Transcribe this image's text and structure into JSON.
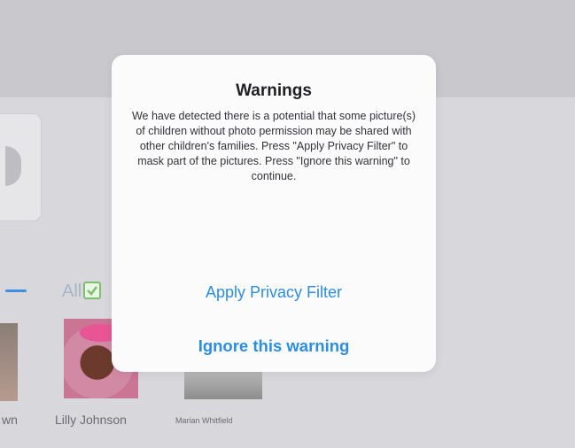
{
  "background": {
    "tab_label": "All",
    "students": [
      {
        "name": "wn"
      },
      {
        "name": "Lilly Johnson"
      },
      {
        "name": "Marian Whitfield"
      }
    ]
  },
  "dialog": {
    "title": "Warnings",
    "message": "We have detected there is a potential that some picture(s) of children without photo permission may be shared with other children's families. Press \"Apply Privacy Filter\" to mask part of the pictures. Press \"Ignore this warning\" to continue.",
    "primary_action": "Apply Privacy Filter",
    "secondary_action": "Ignore this warning"
  },
  "colors": {
    "accent": "#2c8de6",
    "check_green": "#7abf6a"
  }
}
